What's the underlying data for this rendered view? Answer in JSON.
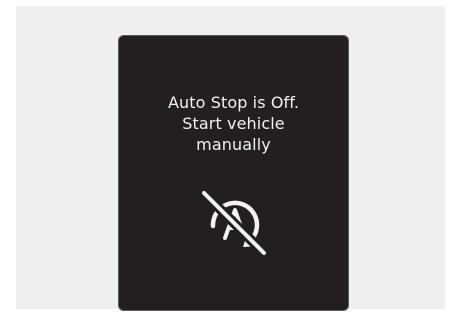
{
  "display": {
    "message_lines": [
      "Auto Stop is Off.",
      "Start vehicle",
      "manually"
    ],
    "icon": "auto-stop-off-icon",
    "colors": {
      "panel": "#231f20",
      "text": "#f2f2f2",
      "background": "#efefef"
    }
  }
}
